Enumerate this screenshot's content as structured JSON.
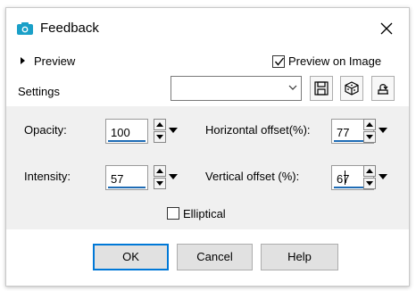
{
  "window": {
    "title": "Feedback"
  },
  "preview": {
    "label": "Preview",
    "preview_on_image_label": "Preview on Image",
    "preview_on_image_checked": true
  },
  "settings": {
    "label": "Settings",
    "value": ""
  },
  "params": {
    "opacity": {
      "label": "Opacity:",
      "value": "100"
    },
    "intensity": {
      "label": "Intensity:",
      "value": "57"
    },
    "horizontal_offset": {
      "label": "Horizontal offset(%):",
      "value": "77"
    },
    "vertical_offset": {
      "label": "Vertical offset (%):",
      "value": "67"
    }
  },
  "elliptical": {
    "label": "Elliptical",
    "checked": false
  },
  "buttons": {
    "ok": "OK",
    "cancel": "Cancel",
    "help": "Help"
  },
  "colors": {
    "accent": "#0078d7",
    "panel_bg": "#f0f0f0",
    "icon_teal": "#1aa0c8"
  }
}
